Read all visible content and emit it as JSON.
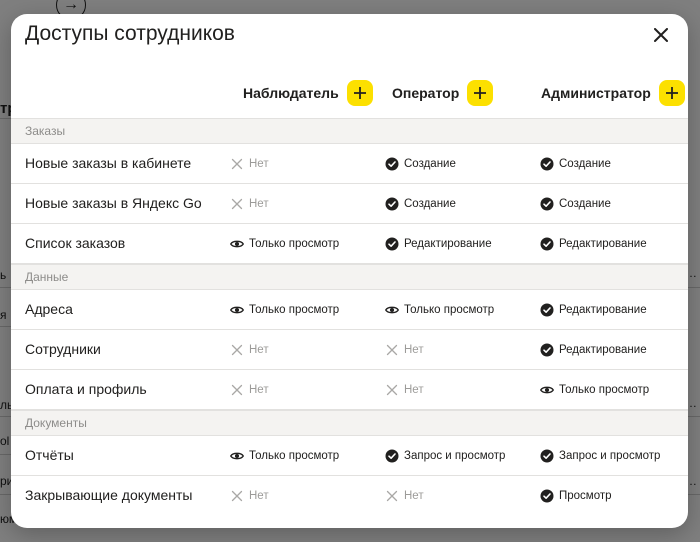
{
  "modal": {
    "title": "Доступы сотрудников"
  },
  "roles": [
    {
      "label": "Наблюдатель"
    },
    {
      "label": "Оператор"
    },
    {
      "label": "Администратор"
    }
  ],
  "sections": [
    {
      "title": "Заказы",
      "rows": [
        {
          "label": "Новые заказы в кабинете",
          "cells": [
            {
              "type": "none",
              "text": "Нет"
            },
            {
              "type": "check",
              "text": "Создание"
            },
            {
              "type": "check",
              "text": "Создание"
            }
          ]
        },
        {
          "label": "Новые заказы в Яндекс Go",
          "cells": [
            {
              "type": "none",
              "text": "Нет"
            },
            {
              "type": "check",
              "text": "Создание"
            },
            {
              "type": "check",
              "text": "Создание"
            }
          ]
        },
        {
          "label": "Список заказов",
          "cells": [
            {
              "type": "eye",
              "text": "Только просмотр"
            },
            {
              "type": "check",
              "text": "Редактирование"
            },
            {
              "type": "check",
              "text": "Редактирование"
            }
          ]
        }
      ]
    },
    {
      "title": "Данные",
      "rows": [
        {
          "label": "Адреса",
          "cells": [
            {
              "type": "eye",
              "text": "Только просмотр"
            },
            {
              "type": "eye",
              "text": "Только просмотр"
            },
            {
              "type": "check",
              "text": "Редактирование"
            }
          ]
        },
        {
          "label": "Сотрудники",
          "cells": [
            {
              "type": "none",
              "text": "Нет"
            },
            {
              "type": "none",
              "text": "Нет"
            },
            {
              "type": "check",
              "text": "Редактирование"
            }
          ]
        },
        {
          "label": "Оплата и профиль",
          "cells": [
            {
              "type": "none",
              "text": "Нет"
            },
            {
              "type": "none",
              "text": "Нет"
            },
            {
              "type": "eye",
              "text": "Только просмотр"
            }
          ]
        }
      ]
    },
    {
      "title": "Документы",
      "rows": [
        {
          "label": "Отчёты",
          "cells": [
            {
              "type": "eye",
              "text": "Только просмотр"
            },
            {
              "type": "check",
              "text": "Запрос и просмотр"
            },
            {
              "type": "check",
              "text": "Запрос и просмотр"
            }
          ]
        },
        {
          "label": "Закрывающие документы",
          "cells": [
            {
              "type": "none",
              "text": "Нет"
            },
            {
              "type": "none",
              "text": "Нет"
            },
            {
              "type": "check",
              "text": "Просмотр"
            }
          ]
        }
      ]
    }
  ],
  "background": {
    "fragments": [
      "тр",
      "ь",
      "я",
      "ль",
      "ol",
      "ри",
      "юм"
    ]
  },
  "colors": {
    "accent": "#fce000",
    "section_bg": "#f4f3f1",
    "muted_text": "#9c9b99"
  }
}
